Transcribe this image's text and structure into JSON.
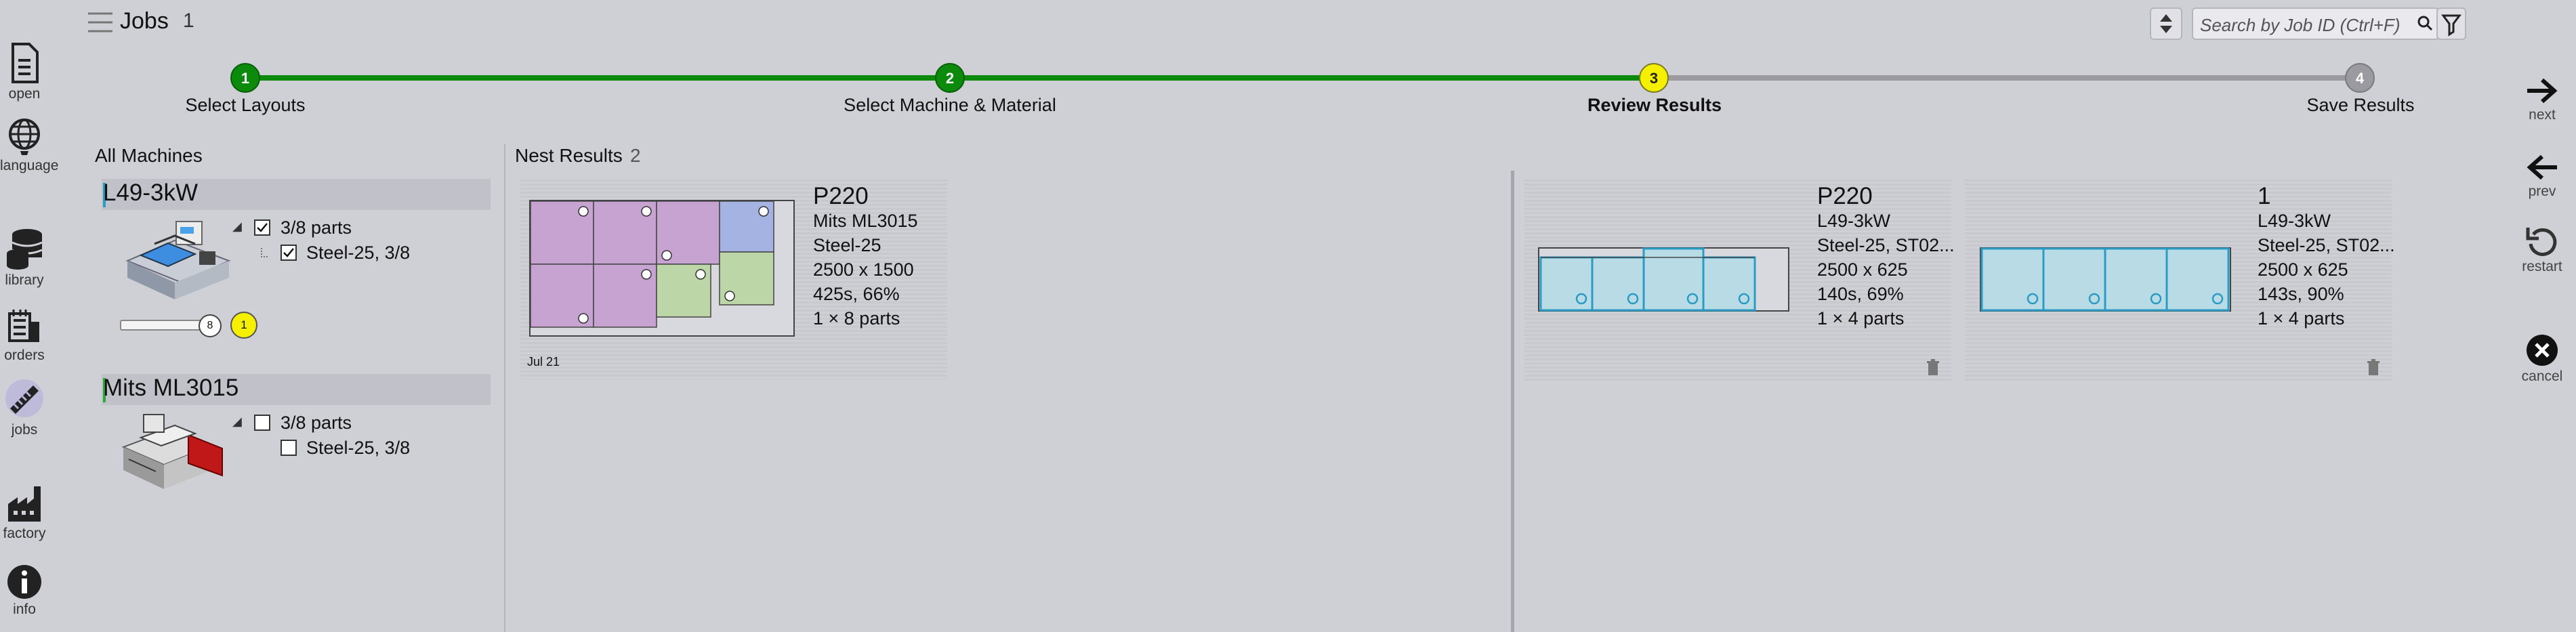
{
  "header": {
    "title": "Jobs",
    "count": "1",
    "search_placeholder": "Search by Job ID (Ctrl+F)"
  },
  "left_rail": [
    {
      "label": "open",
      "icon": "document-icon"
    },
    {
      "label": "language",
      "icon": "globe-icon"
    },
    {
      "label": "library",
      "icon": "database-icon"
    },
    {
      "label": "orders",
      "icon": "orders-icon"
    },
    {
      "label": "jobs",
      "icon": "jobs-icon"
    },
    {
      "label": "factory",
      "icon": "factory-icon"
    },
    {
      "label": "info",
      "icon": "info-icon"
    }
  ],
  "right_rail": [
    {
      "label": "next",
      "icon": "arrow-right-icon"
    },
    {
      "label": "prev",
      "icon": "arrow-left-icon"
    },
    {
      "label": "restart",
      "icon": "restart-icon"
    },
    {
      "label": "cancel",
      "icon": "cancel-icon"
    }
  ],
  "steps": [
    {
      "num": "1",
      "label": "Select Layouts",
      "state": "done"
    },
    {
      "num": "2",
      "label": "Select Machine & Material",
      "state": "done"
    },
    {
      "num": "3",
      "label": "Review Results",
      "state": "current"
    },
    {
      "num": "4",
      "label": "Save Results",
      "state": "pending"
    }
  ],
  "colors": {
    "done": "#0b8a0b",
    "current": "#f5f000",
    "pending": "#9a9aa0",
    "nest_blue": "#2a9cc4"
  },
  "machines_panel": {
    "title": "All Machines",
    "machines": [
      {
        "name": "L49-3kW",
        "parts": "3/8 parts",
        "material": "Steel-25, 3/8",
        "checked": true,
        "slider_value": "8",
        "slider_badge": "1"
      },
      {
        "name": "Mits ML3015",
        "parts": "3/8 parts",
        "material": "Steel-25, 3/8",
        "checked": false
      }
    ]
  },
  "nest_results": {
    "title": "Nest Results",
    "count": "2",
    "left_card": {
      "name": "P220",
      "machine": "Mits ML3015",
      "material": "Steel-25",
      "size": "2500 x 1500",
      "stats": "425s, 66%",
      "parts": "1 × 8 parts",
      "date": "Jul 21"
    },
    "right_cards": [
      {
        "name": "P220",
        "machine": "L49-3kW",
        "material": "Steel-25, ST02...",
        "size": "2500 x 625",
        "stats": "140s, 69%",
        "parts": "1 × 4 parts"
      },
      {
        "name": "1",
        "machine": "L49-3kW",
        "material": "Steel-25, ST02...",
        "size": "2500 x 625",
        "stats": "143s, 90%",
        "parts": "1 × 4 parts"
      }
    ]
  }
}
